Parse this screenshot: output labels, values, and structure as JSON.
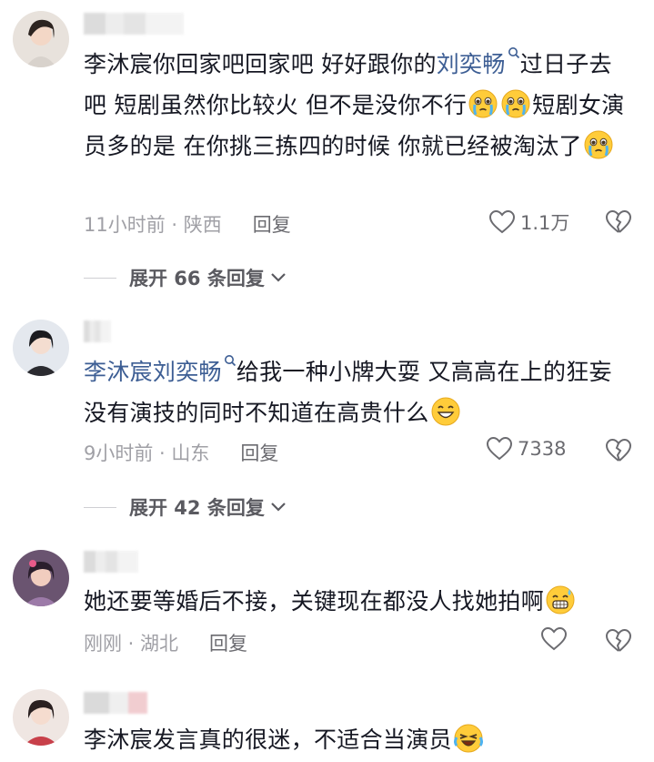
{
  "comments": [
    {
      "username": "",
      "segments": [
        {
          "t": "李沐宸你回家吧回家吧  好好跟你的"
        },
        {
          "t": "刘奕畅",
          "mention": true
        },
        {
          "t": "过日子去吧  短剧虽然你比较火  但不是没你不行"
        },
        {
          "e": "cry"
        },
        {
          "e": "cry"
        },
        {
          "t": "短剧女演员多的是  在你挑三拣四的时候  你就已经被淘汰了"
        },
        {
          "e": "cry"
        }
      ],
      "time": "11小时前 · 陕西",
      "reply": "回复",
      "likes": "1.1万",
      "expand": "展开 66 条回复"
    },
    {
      "username": "",
      "segments": [
        {
          "t": "李沐宸刘奕畅",
          "mention": true
        },
        {
          "t": "给我一种小牌大耍  又高高在上的狂妄  没有演技的同时不知道在高贵什么"
        },
        {
          "e": "grin"
        }
      ],
      "time": "9小时前 · 山东",
      "reply": "回复",
      "likes": "7338",
      "expand": "展开 42 条回复"
    },
    {
      "username": "",
      "segments": [
        {
          "t": "她还要等婚后不接，关键现在都没人找她拍啊"
        },
        {
          "e": "sweat"
        }
      ],
      "time": "刚刚 · 湖北",
      "reply": "回复",
      "likes": ""
    },
    {
      "username": "",
      "segments": [
        {
          "t": "李沐宸发言真的很迷，不适合当演员"
        },
        {
          "e": "laughcry"
        }
      ]
    }
  ],
  "icons": {
    "like": "heart-outline-icon",
    "dislike": "broken-heart-icon",
    "expand": "chevron-down-icon",
    "mention": "search-icon"
  },
  "colors": {
    "mention": "#3d5e94",
    "meta": "#a0a0a6",
    "text": "#161823"
  }
}
